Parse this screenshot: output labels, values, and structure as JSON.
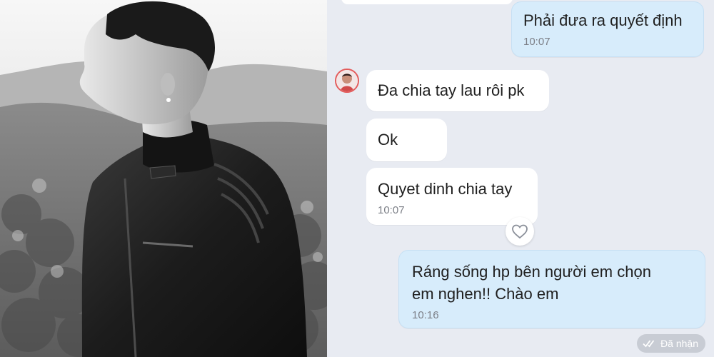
{
  "chat": {
    "messages": [
      {
        "direction": "out",
        "text": "Phải đưa ra quyết định",
        "time": "10:07"
      },
      {
        "direction": "in",
        "text": "Đa chia tay lau rôi pk",
        "time": ""
      },
      {
        "direction": "in",
        "text": "Ok",
        "time": ""
      },
      {
        "direction": "in",
        "text": "Quyet dinh chia tay",
        "time": "10:07"
      },
      {
        "direction": "out",
        "text": "Ráng sống hp bên người em chọn em nghen!! Chào em",
        "time": "10:16"
      }
    ],
    "status": "Đã nhận"
  },
  "colors": {
    "chat_background": "#e8ebf2",
    "incoming_bubble": "#ffffff",
    "outgoing_bubble": "#d7ecfb",
    "timestamp": "#7c7f87",
    "status_pill": "#c8ccd4"
  },
  "icons": {
    "reaction": "heart-icon",
    "status": "double-check-icon"
  }
}
